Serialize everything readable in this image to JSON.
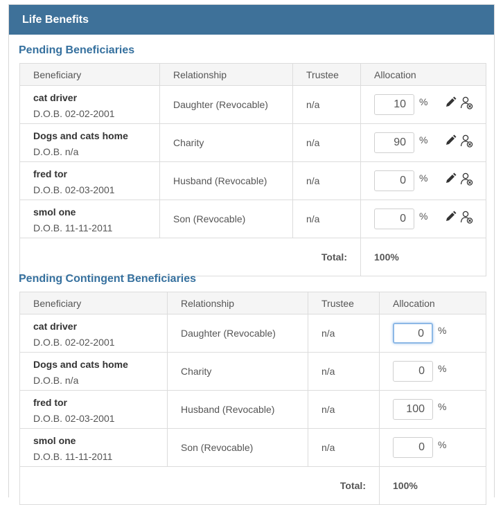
{
  "panel": {
    "title": "Life Benefits"
  },
  "pending": {
    "title": "Pending Beneficiaries",
    "headers": {
      "beneficiary": "Beneficiary",
      "relationship": "Relationship",
      "trustee": "Trustee",
      "allocation": "Allocation"
    },
    "rows": [
      {
        "name": "cat driver",
        "dob": "D.O.B. 02-02-2001",
        "relationship": "Daughter (Revocable)",
        "trustee": "n/a",
        "allocation": "10",
        "pct": "%"
      },
      {
        "name": "Dogs and cats home",
        "dob": "D.O.B. n/a",
        "relationship": "Charity",
        "trustee": "n/a",
        "allocation": "90",
        "pct": "%"
      },
      {
        "name": "fred tor",
        "dob": "D.O.B. 02-03-2001",
        "relationship": "Husband (Revocable)",
        "trustee": "n/a",
        "allocation": "0",
        "pct": "%"
      },
      {
        "name": "smol one",
        "dob": "D.O.B. 11-11-2011",
        "relationship": "Son (Revocable)",
        "trustee": "n/a",
        "allocation": "0",
        "pct": "%"
      }
    ],
    "total_label": "Total:",
    "total_value": "100%"
  },
  "contingent": {
    "title": "Pending Contingent Beneficiaries",
    "headers": {
      "beneficiary": "Beneficiary",
      "relationship": "Relationship",
      "trustee": "Trustee",
      "allocation": "Allocation"
    },
    "rows": [
      {
        "name": "cat driver",
        "dob": "D.O.B. 02-02-2001",
        "relationship": "Daughter (Revocable)",
        "trustee": "n/a",
        "allocation": "0",
        "pct": "%"
      },
      {
        "name": "Dogs and cats home",
        "dob": "D.O.B. n/a",
        "relationship": "Charity",
        "trustee": "n/a",
        "allocation": "0",
        "pct": "%"
      },
      {
        "name": "fred tor",
        "dob": "D.O.B. 02-03-2001",
        "relationship": "Husband (Revocable)",
        "trustee": "n/a",
        "allocation": "100",
        "pct": "%"
      },
      {
        "name": "smol one",
        "dob": "D.O.B. 11-11-2011",
        "relationship": "Son (Revocable)",
        "trustee": "n/a",
        "allocation": "0",
        "pct": "%"
      }
    ],
    "total_label": "Total:",
    "total_value": "100%"
  },
  "icons": {
    "edit": "pencil-icon",
    "remove": "remove-user-icon"
  },
  "colors": {
    "header_bg": "#3e7199",
    "section_title": "#35709e"
  }
}
